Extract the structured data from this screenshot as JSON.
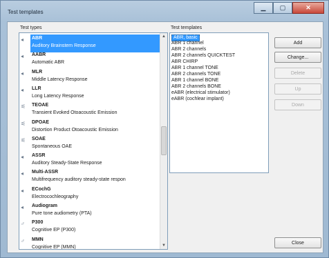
{
  "window": {
    "title": "Test templates"
  },
  "types_panel": {
    "label": "Test types",
    "items": [
      {
        "icon": "ear-icon",
        "glyph": "◂",
        "name": "ABR",
        "desc": "Auditory Brainstem Response",
        "selected": true
      },
      {
        "icon": "ear-icon",
        "glyph": "◂",
        "name": "AABR",
        "desc": "Automatic ABR",
        "selected": false
      },
      {
        "icon": "ear-icon",
        "glyph": "◂",
        "name": "MLR",
        "desc": "Middle Latency Response",
        "selected": false
      },
      {
        "icon": "ear-icon",
        "glyph": "◂",
        "name": "LLR",
        "desc": "Long Latency Response",
        "selected": false
      },
      {
        "icon": "probe-icon",
        "glyph": "⚟",
        "name": "TEOAE",
        "desc": "Transient Evoked Otoacoustic Emission",
        "selected": false
      },
      {
        "icon": "probe-icon",
        "glyph": "⚟",
        "name": "DPOAE",
        "desc": "Distortion Product Otoacoustic Emission",
        "selected": false
      },
      {
        "icon": "probe-icon",
        "glyph": "⚟",
        "name": "SOAE",
        "desc": "Spontaneous OAE",
        "selected": false
      },
      {
        "icon": "ear-icon",
        "glyph": "◂",
        "name": "ASSR",
        "desc": "Auditory Steady-State Response",
        "selected": false
      },
      {
        "icon": "ear-icon",
        "glyph": "◂",
        "name": "Multi-ASSR",
        "desc": "Multifrequency auditory steady-state respon",
        "selected": false
      },
      {
        "icon": "ear-icon",
        "glyph": "◂",
        "name": "ECochG",
        "desc": "Electrocochleography",
        "selected": false
      },
      {
        "icon": "ear-icon",
        "glyph": "◂",
        "name": "Audiogram",
        "desc": "Pure tone audiometry (PTA)",
        "selected": false
      },
      {
        "icon": "brain-icon",
        "glyph": "♂",
        "name": "P300",
        "desc": "Cognitive EP (P300)",
        "selected": false
      },
      {
        "icon": "brain-icon",
        "glyph": "♂",
        "name": "MMN",
        "desc": "Cognitive EP (MMN)",
        "selected": false
      }
    ]
  },
  "templates_panel": {
    "label": "Test templates",
    "items": [
      {
        "text": "ABR, basic",
        "selected": true
      },
      {
        "text": "ABR 1 channel",
        "selected": false
      },
      {
        "text": "ABR 2 channels",
        "selected": false
      },
      {
        "text": "ABR 2 channels QUICKTEST",
        "selected": false
      },
      {
        "text": "ABR CHIRP",
        "selected": false
      },
      {
        "text": "ABR 1 channel TONE",
        "selected": false
      },
      {
        "text": "ABR 2 channels TONE",
        "selected": false
      },
      {
        "text": "ABR 1 channel BONE",
        "selected": false
      },
      {
        "text": "ABR 2 channels BONE",
        "selected": false
      },
      {
        "text": "eABR (electrical stimulator)",
        "selected": false
      },
      {
        "text": "eABR (cochlear implant)",
        "selected": false
      }
    ]
  },
  "buttons": {
    "add": "Add",
    "change": "Change...",
    "delete": "Delete",
    "up": "Up",
    "down": "Down",
    "close": "Close"
  },
  "colors": {
    "selection": "#3399ff",
    "window_frame": "#a9c1d8"
  }
}
